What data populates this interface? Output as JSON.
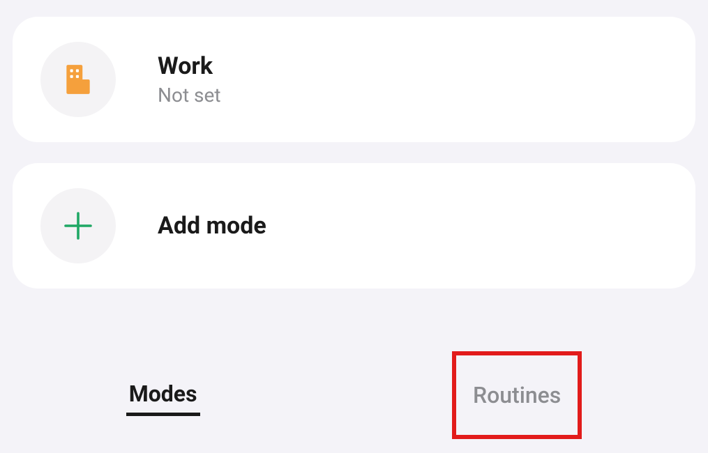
{
  "modes": {
    "work": {
      "title": "Work",
      "subtitle": "Not set"
    },
    "add": {
      "title": "Add mode"
    }
  },
  "tabs": {
    "modes": "Modes",
    "routines": "Routines"
  }
}
